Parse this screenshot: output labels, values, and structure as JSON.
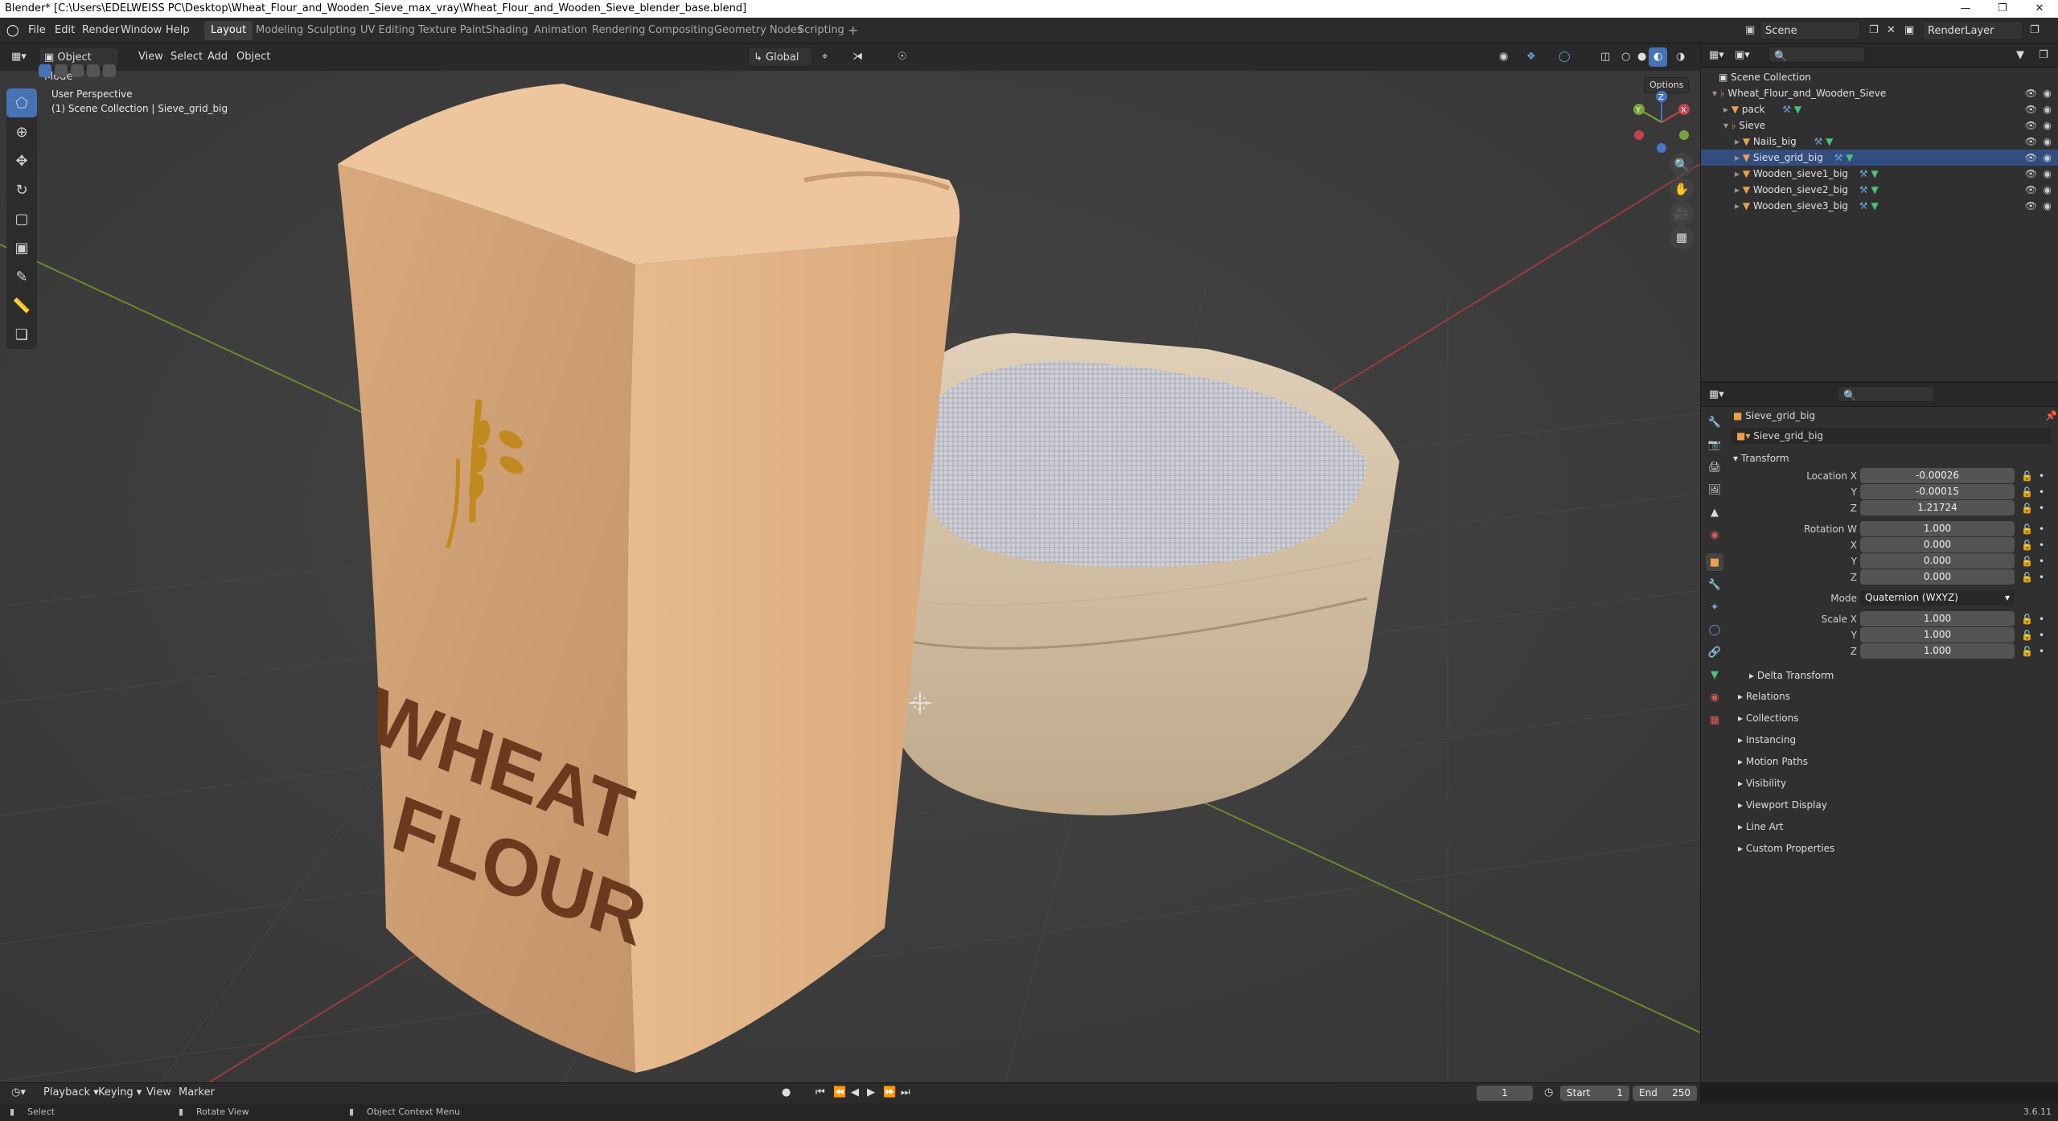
{
  "titlebar": {
    "text": "Blender* [C:\\Users\\EDELWEISS PC\\Desktop\\Wheat_Flour_and_Wooden_Sieve_max_vray\\Wheat_Flour_and_Wooden_Sieve_blender_base.blend]"
  },
  "menus": [
    "File",
    "Edit",
    "Render",
    "Window",
    "Help"
  ],
  "workspaces": [
    "Layout",
    "Modeling",
    "Sculpting",
    "UV Editing",
    "Texture Paint",
    "Shading",
    "Animation",
    "Rendering",
    "Compositing",
    "Geometry Nodes",
    "Scripting"
  ],
  "active_workspace": "Layout",
  "scene": {
    "name": "Scene",
    "render_layer": "RenderLayer"
  },
  "viewport": {
    "mode": "Object Mode",
    "menus": [
      "View",
      "Select",
      "Add",
      "Object"
    ],
    "orientation": "Global",
    "options": "Options",
    "perspective": "User Perspective",
    "collection_info": "(1) Scene Collection | Sieve_grid_big",
    "bag_text_line1": "WHEAT",
    "bag_text_line2": "FLOUR",
    "colors": {
      "bag": "#e5b689",
      "bag_text": "#6b3a1e",
      "wheat_logo": "#c18a1e",
      "sieve_wood": "#d9c7ad",
      "grid_x": "#9a3b3b",
      "grid_y": "#6a8a2e",
      "bg": "#3d3d3d"
    }
  },
  "outliner": {
    "root": "Scene Collection",
    "items": [
      {
        "name": "Wheat_Flour_and_Wooden_Sieve",
        "level": 1,
        "type": "empty"
      },
      {
        "name": "pack",
        "level": 2,
        "type": "mesh"
      },
      {
        "name": "Sieve",
        "level": 2,
        "type": "empty"
      },
      {
        "name": "Nails_big",
        "level": 3,
        "type": "mesh"
      },
      {
        "name": "Sieve_grid_big",
        "level": 3,
        "type": "mesh"
      },
      {
        "name": "Wooden_sieve1_big",
        "level": 3,
        "type": "mesh"
      },
      {
        "name": "Wooden_sieve2_big",
        "level": 3,
        "type": "mesh"
      },
      {
        "name": "Wooden_sieve3_big",
        "level": 3,
        "type": "mesh"
      }
    ]
  },
  "properties": {
    "object_name": "Sieve_grid_big",
    "datablock": "Sieve_grid_big",
    "transform_label": "Transform",
    "location_label": "Location X",
    "rotation_label": "Rotation W",
    "scale_label": "Scale X",
    "axis": [
      "Y",
      "Z",
      "X"
    ],
    "location": [
      "-0.00026",
      "-0.00015",
      "1.21724"
    ],
    "rotation": [
      "1.000",
      "0.000",
      "0.000",
      "0.000"
    ],
    "mode_label": "Mode",
    "mode_value": "Quaternion (WXYZ)",
    "scale": [
      "1.000",
      "1.000",
      "1.000"
    ],
    "delta": "Delta Transform",
    "panels": [
      "Relations",
      "Collections",
      "Instancing",
      "Motion Paths",
      "Visibility",
      "Viewport Display",
      "Line Art",
      "Custom Properties"
    ]
  },
  "timeline": {
    "menus": [
      "Playback",
      "Keying",
      "View",
      "Marker"
    ],
    "current_frame": "1",
    "start_label": "Start",
    "start": "1",
    "end_label": "End",
    "end": "250"
  },
  "status": {
    "select": "Select",
    "rotate": "Rotate View",
    "context": "Object Context Menu",
    "version": "3.6.11"
  }
}
